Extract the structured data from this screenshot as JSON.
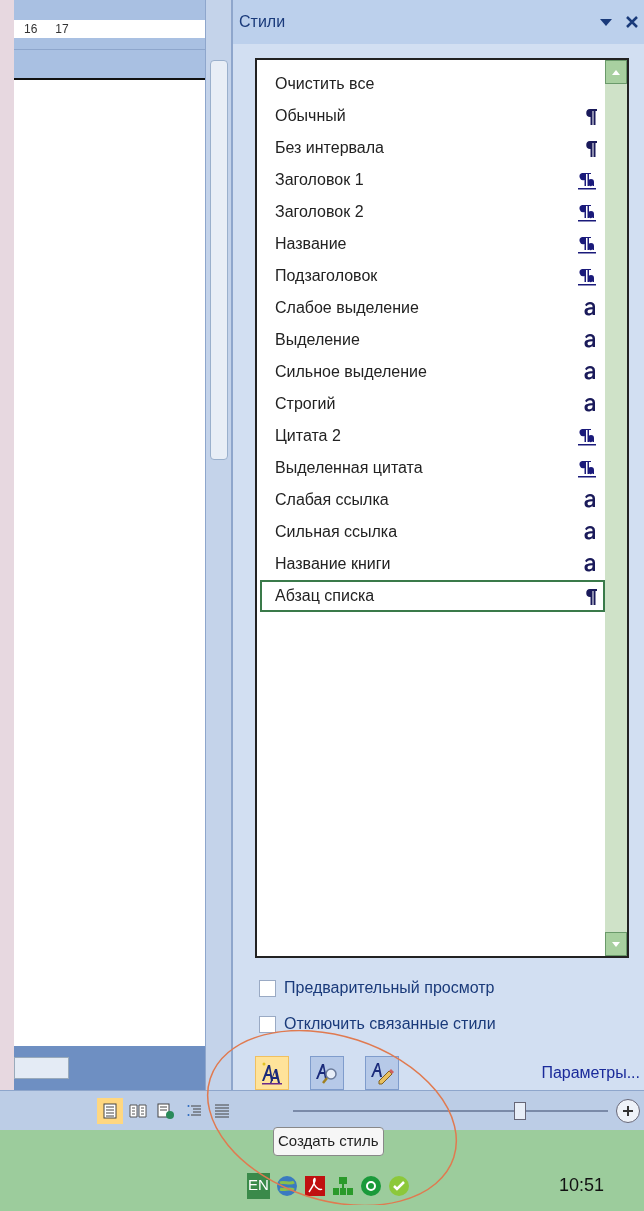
{
  "ruler": {
    "labels": [
      "16",
      "17"
    ]
  },
  "styles_pane": {
    "title": "Стили",
    "items": [
      {
        "label": "Очистить все",
        "kind": "none",
        "selected": false
      },
      {
        "label": "Обычный",
        "kind": "paragraph",
        "selected": false
      },
      {
        "label": "Без интервала",
        "kind": "paragraph",
        "selected": false
      },
      {
        "label": "Заголовок 1",
        "kind": "linked",
        "selected": false
      },
      {
        "label": "Заголовок 2",
        "kind": "linked",
        "selected": false
      },
      {
        "label": "Название",
        "kind": "linked",
        "selected": false
      },
      {
        "label": "Подзаголовок",
        "kind": "linked",
        "selected": false
      },
      {
        "label": "Слабое выделение",
        "kind": "character",
        "selected": false
      },
      {
        "label": "Выделение",
        "kind": "character",
        "selected": false
      },
      {
        "label": "Сильное выделение",
        "kind": "character",
        "selected": false
      },
      {
        "label": "Строгий",
        "kind": "character",
        "selected": false
      },
      {
        "label": "Цитата 2",
        "kind": "linked",
        "selected": false
      },
      {
        "label": "Выделенная цитата",
        "kind": "linked",
        "selected": false
      },
      {
        "label": "Слабая ссылка",
        "kind": "character",
        "selected": false
      },
      {
        "label": "Сильная ссылка",
        "kind": "character",
        "selected": false
      },
      {
        "label": "Название книги",
        "kind": "character",
        "selected": false
      },
      {
        "label": "Абзац списка",
        "kind": "paragraph",
        "selected": true
      }
    ],
    "options": [
      {
        "label": "Предварительный просмотр",
        "checked": false
      },
      {
        "label": "Отключить связанные стили",
        "checked": false
      }
    ],
    "tool_buttons": [
      {
        "kind": "new",
        "selected": true
      },
      {
        "kind": "inspect",
        "selected": false
      },
      {
        "kind": "manage",
        "selected": false
      }
    ],
    "link": "Параметры..."
  },
  "status_bar": {
    "views": [
      {
        "kind": "page",
        "selected": true
      },
      {
        "kind": "reading",
        "selected": false
      },
      {
        "kind": "web",
        "selected": false
      },
      {
        "kind": "outline",
        "selected": false
      },
      {
        "kind": "draft",
        "selected": false
      }
    ],
    "zoom": {
      "level": 0.72
    },
    "tooltip": "Создать стиль"
  },
  "taskbar": {
    "language": "EN",
    "clock": "10:51"
  }
}
